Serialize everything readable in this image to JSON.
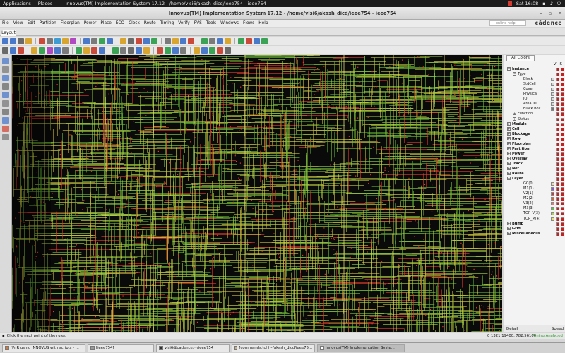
{
  "gnome": {
    "applications": "Applications",
    "places": "Places",
    "window_title": "Innovus(TM) Implementation System 17.12 - /home/vlsi6/akash_dicd/ieee754 - ieee754",
    "clock": "Sat 16:08"
  },
  "window": {
    "title": "Innovus(TM) Implementation System 17.12 - /home/vlsi6/akash_dicd/ieee754 - ieee754"
  },
  "menu": {
    "items": [
      "File",
      "View",
      "Edit",
      "Partition",
      "Floorplan",
      "Power",
      "Place",
      "ECO",
      "Clock",
      "Route",
      "Timing",
      "Verify",
      "PVS",
      "Tools",
      "Windows",
      "Flows",
      "Help"
    ],
    "search_placeholder": "online help",
    "logo": "cādence"
  },
  "tabs": {
    "layout": "Layout"
  },
  "panel": {
    "all_colors": "All Colors",
    "col_v": "V",
    "col_s": "S",
    "tree": [
      {
        "label": "Instance",
        "level": 0,
        "bold": true,
        "plus": "−"
      },
      {
        "label": "Type",
        "level": 1,
        "bold": false,
        "plus": "−"
      },
      {
        "label": "Block",
        "level": 2,
        "bold": false,
        "color": "#d8d8d8"
      },
      {
        "label": "StdCell",
        "level": 2,
        "bold": false,
        "color": "#d8d8d8"
      },
      {
        "label": "Cover",
        "level": 2,
        "bold": false,
        "color": "#d8d8d8"
      },
      {
        "label": "Physical",
        "level": 2,
        "bold": false,
        "color": "#d8d8d8"
      },
      {
        "label": "IO",
        "level": 2,
        "bold": false,
        "color": "#d8d8d8"
      },
      {
        "label": "Area IO",
        "level": 2,
        "bold": false,
        "color": "#d8d8d8"
      },
      {
        "label": "Black Box",
        "level": 2,
        "bold": false,
        "color": "#777777"
      },
      {
        "label": "Function",
        "level": 1,
        "bold": false,
        "plus": "+"
      },
      {
        "label": "Status",
        "level": 1,
        "bold": false,
        "plus": "+"
      },
      {
        "label": "Module",
        "level": 0,
        "bold": true,
        "plus": "+"
      },
      {
        "label": "Cell",
        "level": 0,
        "bold": true,
        "plus": "+"
      },
      {
        "label": "Blockage",
        "level": 0,
        "bold": true,
        "plus": "+"
      },
      {
        "label": "Row",
        "level": 0,
        "bold": true,
        "plus": "+"
      },
      {
        "label": "Floorplan",
        "level": 0,
        "bold": true,
        "plus": "+"
      },
      {
        "label": "Partition",
        "level": 0,
        "bold": true,
        "plus": "+"
      },
      {
        "label": "Power",
        "level": 0,
        "bold": true,
        "plus": "+"
      },
      {
        "label": "Overlay",
        "level": 0,
        "bold": true,
        "plus": "+"
      },
      {
        "label": "Track",
        "level": 0,
        "bold": true,
        "plus": "+"
      },
      {
        "label": "Net",
        "level": 0,
        "bold": true,
        "plus": "+"
      },
      {
        "label": "Route",
        "level": 0,
        "bold": true,
        "plus": "+"
      },
      {
        "label": "Layer",
        "level": 0,
        "bold": true,
        "plus": "−"
      },
      {
        "label": "GC(0)",
        "level": 2,
        "bold": false,
        "color": "#f2d7a8"
      },
      {
        "label": "M1(1)",
        "level": 2,
        "bold": false,
        "color": "#8a5cc0"
      },
      {
        "label": "V2(1)",
        "level": 2,
        "bold": false,
        "color": "#c93a3a"
      },
      {
        "label": "M2(2)",
        "level": 2,
        "bold": false,
        "color": "#cc6a3a"
      },
      {
        "label": "V3(2)",
        "level": 2,
        "bold": false,
        "color": "#e07a7a"
      },
      {
        "label": "M3(3)",
        "level": 2,
        "bold": false,
        "color": "#5fbf4c"
      },
      {
        "label": "TOP_V(3)",
        "level": 2,
        "bold": false,
        "color": "#b0d050"
      },
      {
        "label": "TOP_M(4)",
        "level": 2,
        "bold": false,
        "color": "#e8e070"
      },
      {
        "label": "Bump",
        "level": 0,
        "bold": true,
        "plus": "+"
      },
      {
        "label": "Grid",
        "level": 0,
        "bold": true,
        "plus": "+"
      },
      {
        "label": "Miscellaneous",
        "level": 0,
        "bold": true,
        "plus": "+"
      }
    ],
    "detail": "Detail",
    "speed": "Speed"
  },
  "status": {
    "message": "Click the next point of the ruler.",
    "coords": "0  1321.19400, 782.56100",
    "timing": "Timing Analyzed"
  },
  "taskbar": [
    {
      "label": "[PnR using INNOVUS with scripts - ...",
      "icon": "#e8732a",
      "active": false
    },
    {
      "label": "[ieee754]",
      "icon": "#9a9a9a",
      "active": false
    },
    {
      "label": "vlsi6@cadence:~/ieee754",
      "icon": "#333333",
      "active": false
    },
    {
      "label": "[commands.tcl (~/akash_dicd/ieee75...",
      "icon": "#c9b28a",
      "active": false
    },
    {
      "label": "Innovus(TM) Implementation Syste...",
      "icon": "#ffffff",
      "active": true
    }
  ]
}
